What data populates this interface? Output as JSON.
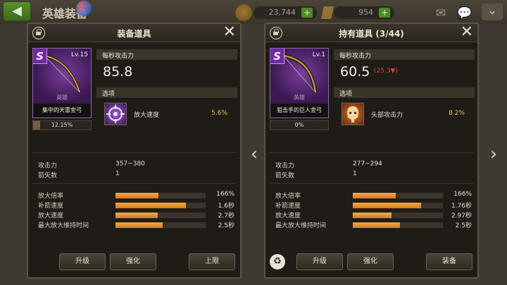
{
  "topbar": {
    "back_icon": "back-arrow-icon",
    "title": "英雄装备",
    "gold": "23,744",
    "gems": "954",
    "plus": "+",
    "icons": [
      "mail-icon",
      "chat-icon",
      "close-x-icon",
      "chevron-down-icon"
    ]
  },
  "nav": {
    "prev": "‹",
    "next": "›"
  },
  "equipped": {
    "title": "装备道具",
    "item": {
      "grade": "S",
      "level": "Lv.15",
      "rarity": "英雄",
      "name": "集中的天雷金弓",
      "exp": "12.15%",
      "exp_fraction": 0.1215
    },
    "dps_label": "每秒攻击力",
    "dps_value": "85.8",
    "option_label": "选项",
    "option": {
      "name": "放大速度",
      "value": "5.6%"
    },
    "info": [
      {
        "label": "攻击力",
        "value": "357~380"
      },
      {
        "label": "箭矢数",
        "value": "1"
      }
    ],
    "bars": [
      {
        "label": "放大倍率",
        "value": "166%",
        "fill": 0.48
      },
      {
        "label": "补箭速度",
        "value": "1.6秒",
        "fill": 0.78
      },
      {
        "label": "放大速度",
        "value": "2.7秒",
        "fill": 0.47
      },
      {
        "label": "最大放大维持时间",
        "value": "2.5秒",
        "fill": 0.52
      }
    ],
    "buttons": {
      "upgrade": "升级",
      "enhance": "强化",
      "limit": "上限"
    }
  },
  "held": {
    "title": "持有道具 (3/44)",
    "item": {
      "grade": "S",
      "level": "Lv.1",
      "rarity": "英雄",
      "name": "狙击手的巨人金弓",
      "exp": "0%",
      "exp_fraction": 0
    },
    "dps_label": "每秒攻击力",
    "dps_value": "60.5",
    "dps_delta": "(25.3▼)",
    "option_label": "选项",
    "option": {
      "name": "头部攻击力",
      "value": "8.2%"
    },
    "info": [
      {
        "label": "攻击力",
        "value": "277~294"
      },
      {
        "label": "箭矢数",
        "value": "1"
      }
    ],
    "bars": [
      {
        "label": "放大倍率",
        "value": "166%",
        "fill": 0.48
      },
      {
        "label": "补箭速度",
        "value": "1.76秒",
        "fill": 0.76
      },
      {
        "label": "放大速度",
        "value": "2.97秒",
        "fill": 0.43
      },
      {
        "label": "最大放大维持时间",
        "value": "2.5秒",
        "fill": 0.52
      }
    ],
    "buttons": {
      "upgrade": "升级",
      "enhance": "强化",
      "equip": "装备"
    }
  },
  "colors": {
    "bar": "#e8922a",
    "option_value": "#e5c54a",
    "delta": "#e04040",
    "grade": "#6e2aa0"
  }
}
